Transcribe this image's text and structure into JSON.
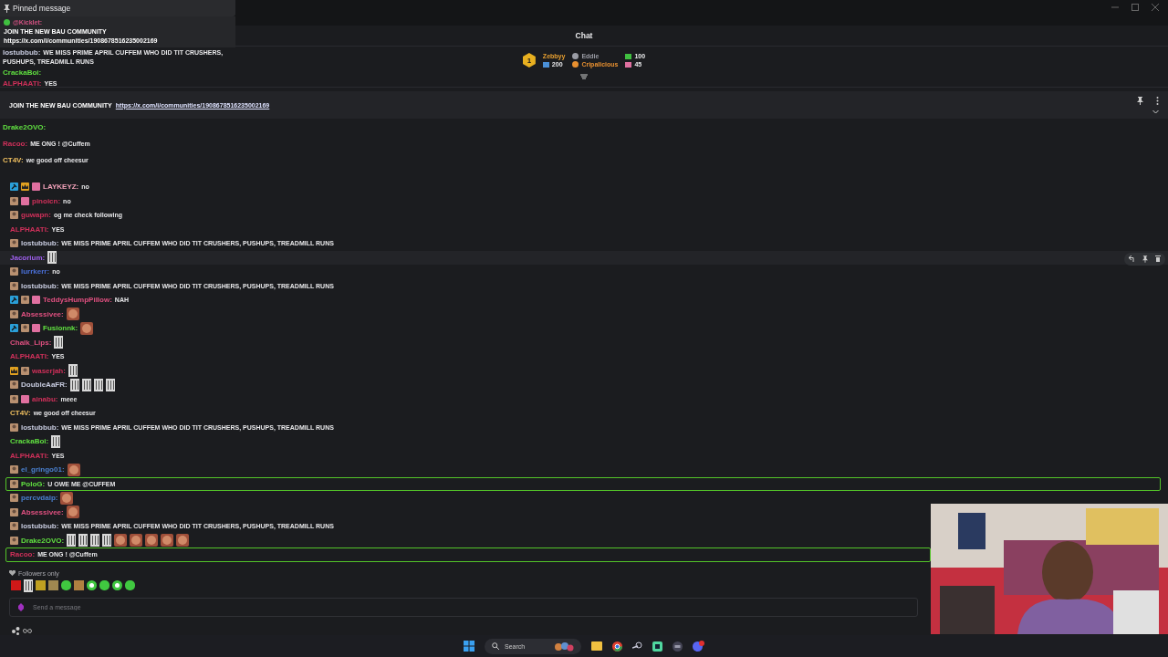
{
  "overlay": {
    "pinned_title": "Pinned message",
    "pinned_author": "@Kicklet:",
    "pinned_lines": [
      "JOIN THE NEW BAU COMMUNITY",
      "https://x.com/i/communities/1908678516235002169"
    ],
    "messages": [
      {
        "user": "lostubbub:",
        "color": "#c8cce0",
        "text": "WE MISS PRIME APRIL CUFFEM WHO DID TIT CRUSHERS, PUSHUPS, TREADMILL RUNS"
      },
      {
        "user": "CrackaBoi:",
        "color": "#60e040"
      },
      {
        "user": "ALPHAATI:",
        "color": "#d0305a",
        "text": "YES"
      }
    ],
    "later_messages": [
      {
        "user": "Drake2OVO:",
        "color": "#60e040"
      },
      {
        "user": "Racoo:",
        "color": "#d0305a",
        "text": "ME ONG ! @Cuffem"
      },
      {
        "user": "CT4V:",
        "color": "#f0c060",
        "text": "we good off cheesur"
      }
    ]
  },
  "chat": {
    "title": "Chat",
    "leaderboard": {
      "rank": "1",
      "top_name": "Zebbyy",
      "top_amount": "200",
      "others": [
        {
          "name": "Eddie",
          "color": "#9a9ca4"
        },
        {
          "name": "Cripalicious",
          "color": "#e89030"
        }
      ],
      "counts": [
        {
          "value": "100",
          "color": "#40c040"
        },
        {
          "value": "45",
          "color": "#e070a0"
        }
      ]
    },
    "pinned": {
      "text": "JOIN THE NEW BAU COMMUNITY",
      "link": "https://x.com/i/communities/1908678516235002169"
    },
    "messages": [
      {
        "user": "LAYKEYZ:",
        "color": "#f0a0b8",
        "text": "no",
        "badges": [
          {
            "kind": "mod"
          },
          {
            "kind": "crown"
          },
          {
            "kind": "gift"
          }
        ],
        "highlighted": false,
        "hovered": false
      },
      {
        "user": "pinoicn:",
        "color": "#d0305a",
        "text": "no",
        "badges": [
          {
            "kind": "avatar"
          },
          {
            "kind": "gift"
          }
        ],
        "highlighted": false,
        "hovered": false
      },
      {
        "user": "guwapn:",
        "color": "#d0305a",
        "text": "og me check following",
        "badges": [
          {
            "kind": "avatar"
          }
        ],
        "highlighted": false,
        "hovered": false
      },
      {
        "user": "ALPHAATI:",
        "color": "#d0305a",
        "text": "YES",
        "highlighted": false,
        "hovered": false
      },
      {
        "user": "lostubbub:",
        "color": "#c8cce0",
        "text": "WE MISS PRIME APRIL CUFFEM WHO DID TIT CRUSHERS, PUSHUPS, TREADMILL RUNS",
        "badges": [
          {
            "kind": "avatar"
          }
        ],
        "highlighted": false,
        "hovered": false
      },
      {
        "user": "Jacorium:",
        "color": "#a060f0",
        "emotes": [
          {
            "kind": "bau"
          }
        ],
        "highlighted": false,
        "hovered": true
      },
      {
        "user": "lurrkerr:",
        "color": "#4a70d8",
        "text": "no",
        "badges": [
          {
            "kind": "avatar"
          }
        ],
        "highlighted": false,
        "hovered": false
      },
      {
        "user": "lostubbub:",
        "color": "#c8cce0",
        "text": "WE MISS PRIME APRIL CUFFEM WHO DID TIT CRUSHERS, PUSHUPS, TREADMILL RUNS",
        "badges": [
          {
            "kind": "avatar"
          }
        ],
        "highlighted": false,
        "hovered": false
      },
      {
        "user": "TeddysHumpPillow:",
        "color": "#e05080",
        "text": "NAH",
        "badges": [
          {
            "kind": "mod"
          },
          {
            "kind": "avatar"
          },
          {
            "kind": "gift"
          }
        ],
        "highlighted": false,
        "hovered": false
      },
      {
        "user": "Absessivee:",
        "color": "#e05080",
        "badges": [
          {
            "kind": "avatar"
          }
        ],
        "emotes": [
          {
            "kind": "face"
          }
        ],
        "highlighted": false,
        "hovered": false
      },
      {
        "user": "Fusionnk:",
        "color": "#60e040",
        "badges": [
          {
            "kind": "mod"
          },
          {
            "kind": "avatar"
          },
          {
            "kind": "gift"
          }
        ],
        "emotes": [
          {
            "kind": "face"
          }
        ],
        "highlighted": false,
        "hovered": false
      },
      {
        "user": "Chalk_Lips:",
        "color": "#e05080",
        "emotes": [
          {
            "kind": "bau"
          }
        ],
        "highlighted": false,
        "hovered": false
      },
      {
        "user": "ALPHAATI:",
        "color": "#d0305a",
        "text": "YES",
        "highlighted": false,
        "hovered": false
      },
      {
        "user": "waserjah:",
        "color": "#d0305a",
        "badges": [
          {
            "kind": "crown"
          },
          {
            "kind": "avatar"
          }
        ],
        "emotes": [
          {
            "kind": "bau"
          }
        ],
        "highlighted": false,
        "hovered": false
      },
      {
        "user": "DoubleAaFR:",
        "color": "#c8cce0",
        "badges": [
          {
            "kind": "avatar"
          }
        ],
        "emotes": [
          {
            "kind": "bau"
          },
          {
            "kind": "bau"
          },
          {
            "kind": "bau"
          },
          {
            "kind": "bau"
          }
        ],
        "highlighted": false,
        "hovered": false
      },
      {
        "user": "ainabu:",
        "color": "#d0305a",
        "text": "meee",
        "badges": [
          {
            "kind": "avatar"
          },
          {
            "kind": "gift"
          }
        ],
        "highlighted": false,
        "hovered": false
      },
      {
        "user": "CT4V:",
        "color": "#f0c060",
        "text": "we good off cheesur",
        "highlighted": false,
        "hovered": false
      },
      {
        "user": "lostubbub:",
        "color": "#c8cce0",
        "text": "WE MISS PRIME APRIL CUFFEM WHO DID TIT CRUSHERS, PUSHUPS, TREADMILL RUNS",
        "badges": [
          {
            "kind": "avatar"
          }
        ],
        "highlighted": false,
        "hovered": false
      },
      {
        "user": "CrackaBoi:",
        "color": "#60e040",
        "emotes": [
          {
            "kind": "bau"
          }
        ],
        "highlighted": false,
        "hovered": false
      },
      {
        "user": "ALPHAATI:",
        "color": "#d0305a",
        "text": "YES",
        "highlighted": false,
        "hovered": false
      },
      {
        "user": "el_gringo01:",
        "color": "#4a80d0",
        "badges": [
          {
            "kind": "avatar"
          }
        ],
        "emotes": [
          {
            "kind": "face"
          }
        ],
        "highlighted": false,
        "hovered": false
      },
      {
        "user": "PoloG:",
        "color": "#60e040",
        "text": "U OWE ME @CUFFEM",
        "badges": [
          {
            "kind": "avatar"
          }
        ],
        "highlighted": true,
        "hovered": false
      },
      {
        "user": "percvdalp:",
        "color": "#4a80d0",
        "badges": [
          {
            "kind": "avatar"
          }
        ],
        "emotes": [
          {
            "kind": "face"
          }
        ],
        "highlighted": false,
        "hovered": false
      },
      {
        "user": "Absessivee:",
        "color": "#e05080",
        "badges": [
          {
            "kind": "avatar"
          }
        ],
        "emotes": [
          {
            "kind": "face"
          }
        ],
        "highlighted": false,
        "hovered": false
      },
      {
        "user": "lostubbub:",
        "color": "#c8cce0",
        "text": "WE MISS PRIME APRIL CUFFEM WHO DID TIT CRUSHERS, PUSHUPS, TREADMILL RUNS",
        "badges": [
          {
            "kind": "avatar"
          }
        ],
        "highlighted": false,
        "hovered": false
      },
      {
        "user": "Drake2OVO:",
        "color": "#60e040",
        "badges": [
          {
            "kind": "avatar"
          }
        ],
        "emotes": [
          {
            "kind": "bau"
          },
          {
            "kind": "bau"
          },
          {
            "kind": "bau"
          },
          {
            "kind": "bau"
          },
          {
            "kind": "face"
          },
          {
            "kind": "face"
          },
          {
            "kind": "face"
          },
          {
            "kind": "face"
          },
          {
            "kind": "face"
          }
        ],
        "highlighted": false,
        "hovered": false
      },
      {
        "user": "Racoo:",
        "color": "#d0305a",
        "text": "ME ONG ! @Cuffem",
        "highlighted": true,
        "hovered": false
      }
    ],
    "mode": "Followers only",
    "emote_bar": [
      {
        "kind": "square",
        "color": "#d01818"
      },
      {
        "kind": "bau",
        "color": "#d8d8d8"
      },
      {
        "kind": "square",
        "color": "#c0a020"
      },
      {
        "kind": "square",
        "color": "#a08850"
      },
      {
        "kind": "blob",
        "color": "#40c840"
      },
      {
        "kind": "square",
        "color": "#b08040"
      },
      {
        "kind": "chip",
        "color": "#40c840"
      },
      {
        "kind": "blob",
        "color": "#40c840"
      },
      {
        "kind": "chip",
        "color": "#40c840"
      },
      {
        "kind": "blob",
        "color": "#40c840"
      }
    ],
    "input": {
      "placeholder": "Send a message"
    }
  },
  "taskbar": {
    "search": "Search"
  }
}
